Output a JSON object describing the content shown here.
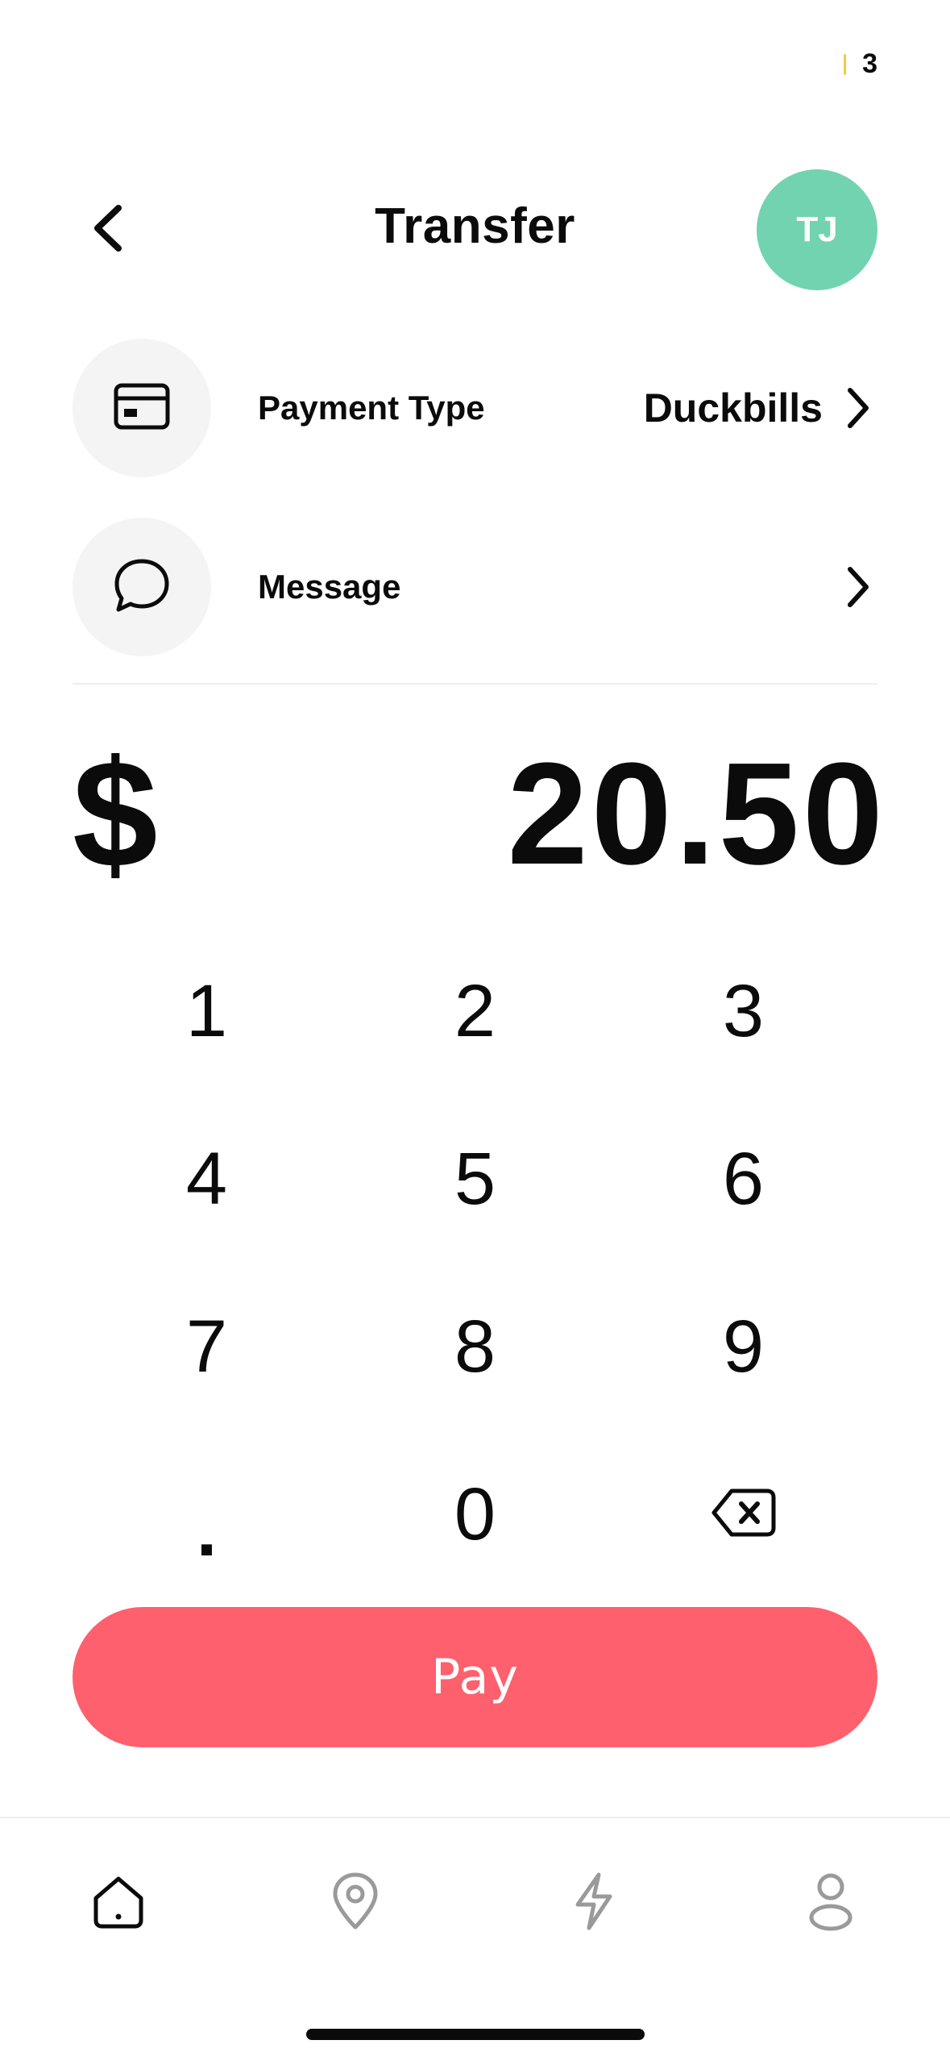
{
  "status_bar": {
    "count": "3",
    "indicator_color": "#f7c948"
  },
  "header": {
    "back_icon": "chevron-left-icon",
    "title": "Transfer",
    "avatar_initials": "TJ",
    "avatar_color": "#72d3b0"
  },
  "payment_type": {
    "icon": "credit-card-icon",
    "label": "Payment Type",
    "value": "Duckbills",
    "chevron_icon": "chevron-right-icon"
  },
  "message": {
    "icon": "chat-bubble-icon",
    "label": "Message",
    "chevron_icon": "chevron-right-icon"
  },
  "amount": {
    "currency": "$",
    "value": "20.50"
  },
  "keypad": {
    "keys": [
      "1",
      "2",
      "3",
      "4",
      "5",
      "6",
      "7",
      "8",
      "9",
      ".",
      "0"
    ],
    "backspace_icon": "backspace-icon"
  },
  "pay_button": {
    "label": "Pay",
    "color": "#fe606d"
  },
  "tab_bar": {
    "tabs": [
      {
        "icon": "home-icon",
        "active": true
      },
      {
        "icon": "location-pin-icon",
        "active": false
      },
      {
        "icon": "lightning-bolt-icon",
        "active": false
      },
      {
        "icon": "user-icon",
        "active": false
      }
    ],
    "active_color": "#0b0b0b",
    "inactive_color": "#9a9a9a"
  }
}
